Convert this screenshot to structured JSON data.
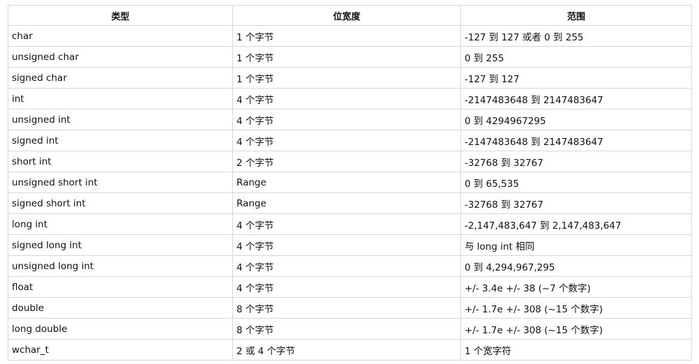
{
  "table": {
    "headers": [
      "类型",
      "位宽度",
      "范围"
    ],
    "rows": [
      [
        "char",
        "1 个字节",
        "-127 到 127 或者 0 到 255"
      ],
      [
        "unsigned char",
        "1 个字节",
        "0 到 255"
      ],
      [
        "signed char",
        "1 个字节",
        "-127 到 127"
      ],
      [
        "int",
        "4 个字节",
        "-2147483648 到 2147483647"
      ],
      [
        "unsigned int",
        "4 个字节",
        "0 到 4294967295"
      ],
      [
        "signed int",
        "4 个字节",
        "-2147483648 到 2147483647"
      ],
      [
        "short int",
        "2 个字节",
        "-32768 到 32767"
      ],
      [
        "unsigned short int",
        "Range",
        "0 到 65,535"
      ],
      [
        "signed short int",
        "Range",
        "-32768 到 32767"
      ],
      [
        "long int",
        "4 个字节",
        "-2,147,483,647 到 2,147,483,647"
      ],
      [
        "signed long int",
        "4 个字节",
        "与 long int 相同"
      ],
      [
        "unsigned long int",
        "4 个字节",
        "0 到 4,294,967,295"
      ],
      [
        "float",
        "4 个字节",
        "+/- 3.4e +/- 38 (~7 个数字)"
      ],
      [
        "double",
        "8 个字节",
        "+/- 1.7e +/- 308 (~15 个数字)"
      ],
      [
        "long double",
        "8 个字节",
        "+/- 1.7e +/- 308 (~15 个数字)"
      ],
      [
        "wchar_t",
        "2 或 4 个字节",
        "1 个宽字符"
      ]
    ]
  }
}
